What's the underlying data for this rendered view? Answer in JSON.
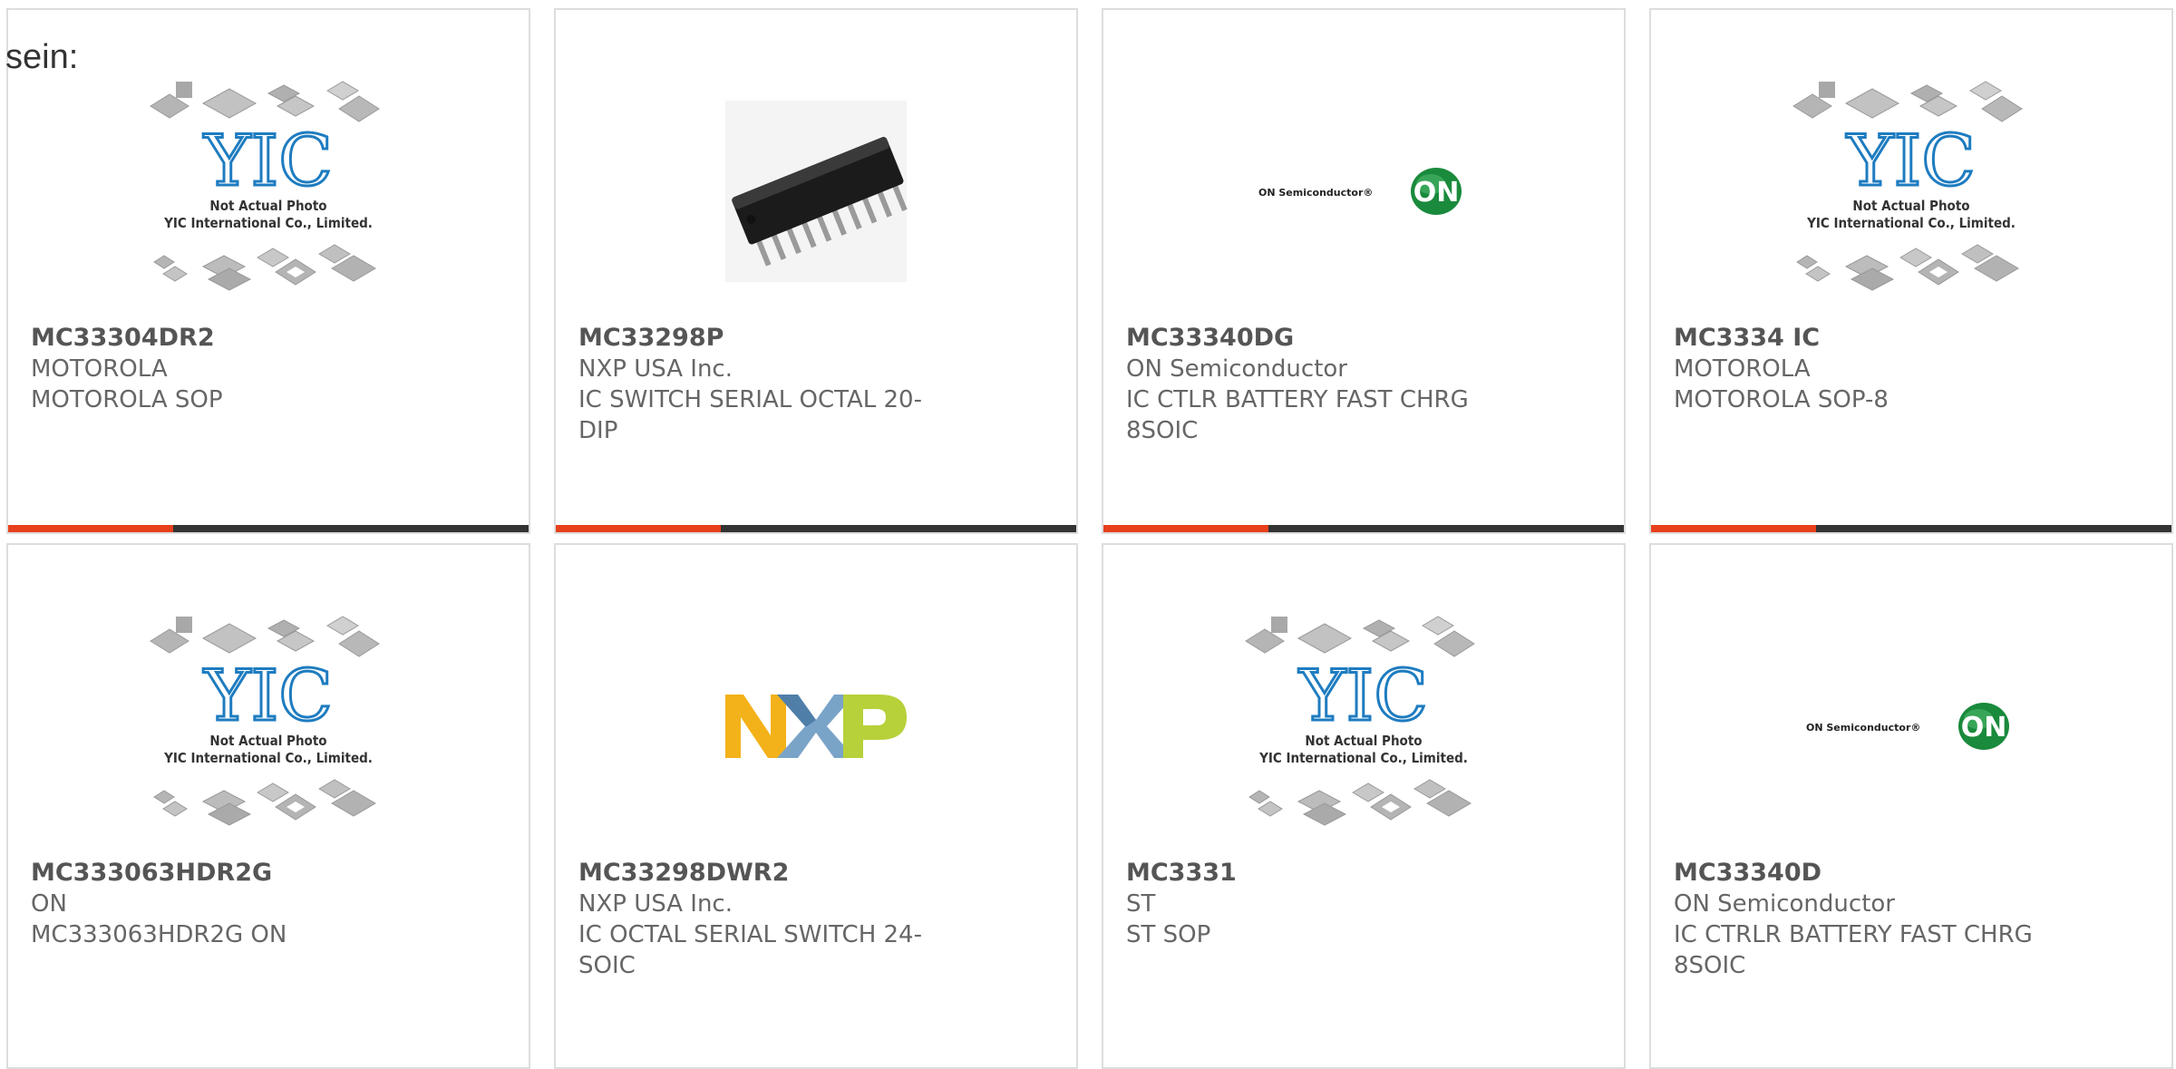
{
  "lead_text": "sein:",
  "colors": {
    "accent": "#e8401c",
    "bar": "#333333",
    "border": "#dddddd",
    "yic_blue": "#1e7cc0"
  },
  "placeholder_photo": {
    "line1": "Not Actual Photo",
    "line2": "YIC International Co., Limited.",
    "logo": "YIC"
  },
  "on_logo": {
    "wordmark": "ON Semiconductor",
    "mark": "ON"
  },
  "products": [
    {
      "part": "MC33304DR2",
      "manufacturer": "MOTOROLA",
      "description": "MOTOROLA SOP",
      "photo": "yic-placeholder"
    },
    {
      "part": "MC33298P",
      "manufacturer": "NXP USA Inc.",
      "description": "IC SWITCH SERIAL OCTAL 20-DIP",
      "photo": "dip-chip"
    },
    {
      "part": "MC33340DG",
      "manufacturer": "ON Semiconductor",
      "description": "IC CTLR BATTERY FAST CHRG 8SOIC",
      "photo": "on-semi-logo"
    },
    {
      "part": "MC3334 IC",
      "manufacturer": "MOTOROLA",
      "description": "MOTOROLA SOP-8",
      "photo": "yic-placeholder"
    },
    {
      "part": "MC333063HDR2G",
      "manufacturer": "ON",
      "description": "MC333063HDR2G ON",
      "photo": "yic-placeholder"
    },
    {
      "part": "MC33298DWR2",
      "manufacturer": "NXP USA Inc.",
      "description": "IC OCTAL SERIAL SWITCH 24-SOIC",
      "photo": "nxp-logo"
    },
    {
      "part": "MC3331",
      "manufacturer": "ST",
      "description": "ST SOP",
      "photo": "yic-placeholder"
    },
    {
      "part": "MC33340D",
      "manufacturer": "ON Semiconductor",
      "description": "IC CTRLR BATTERY FAST CHRG 8SOIC",
      "photo": "on-semi-logo"
    }
  ]
}
